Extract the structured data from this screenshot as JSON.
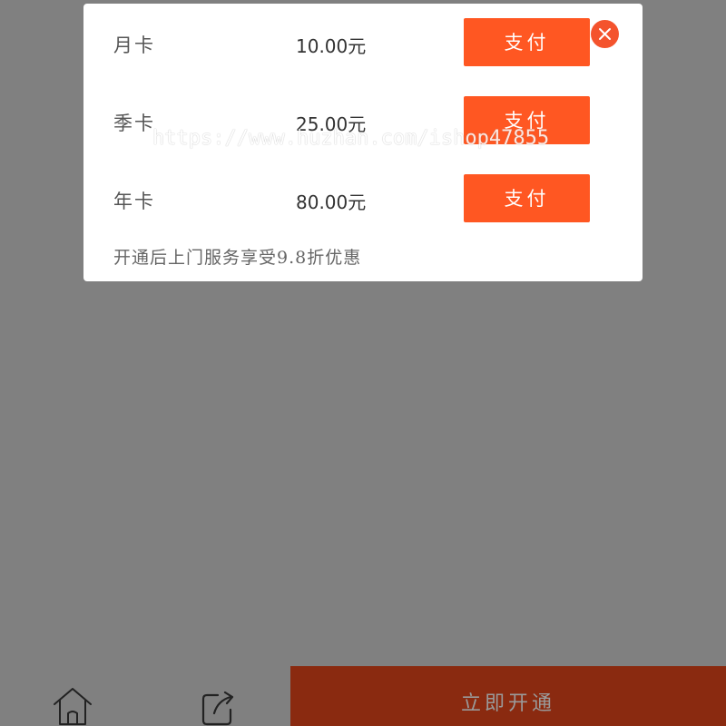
{
  "modal": {
    "options": [
      {
        "name": "月卡",
        "price": "10.00元",
        "pay_label": "支付"
      },
      {
        "name": "季卡",
        "price": "25.00元",
        "pay_label": "支付"
      },
      {
        "name": "年卡",
        "price": "80.00元",
        "pay_label": "支付"
      }
    ],
    "note": "开通后上门服务享受9.8折优惠",
    "close_icon": "close-icon"
  },
  "watermark": "https://www.huzhan.com/ishop47855",
  "bottom_bar": {
    "home_icon": "home-icon",
    "share_icon": "share-icon",
    "open_now_label": "立即开通"
  },
  "colors": {
    "accent": "#ff5722",
    "close": "#f4532d",
    "overlay": "#808080",
    "bottom_button": "#8a2a10"
  }
}
